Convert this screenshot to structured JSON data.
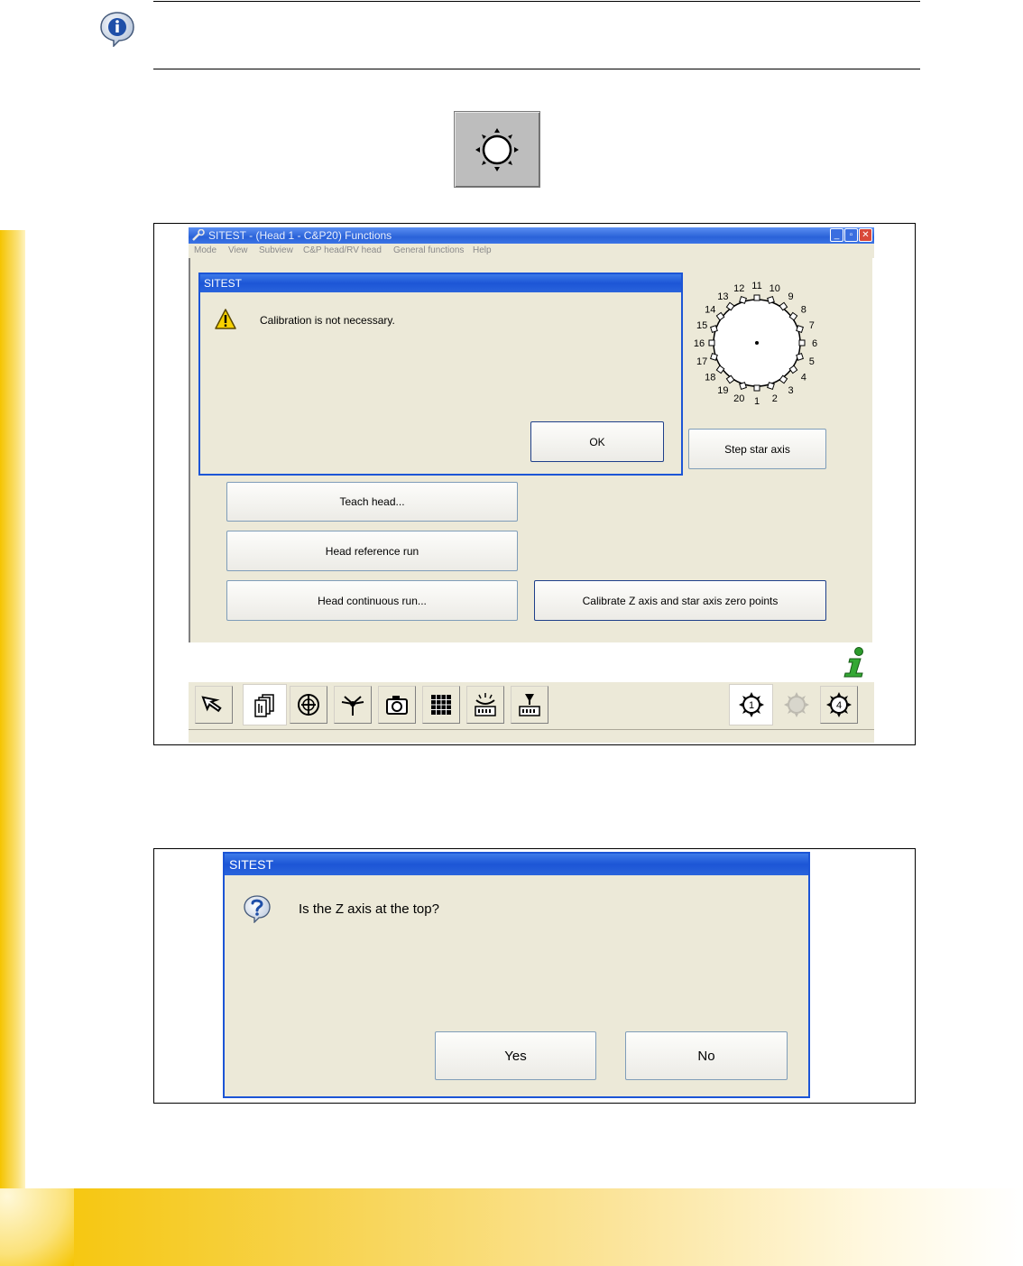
{
  "window": {
    "title": "SITEST - (Head 1 - C&P20) Functions",
    "menu": [
      "Mode",
      "View",
      "Subview",
      "C&P head/RV head",
      "General functions",
      "Help"
    ],
    "buttons": {
      "minimize": "_",
      "restore": "▫",
      "close": "✕"
    }
  },
  "calib_dialog": {
    "title": "SITEST",
    "message": "Calibration is not necessary.",
    "ok_label": "OK"
  },
  "star": {
    "labels": [
      "1",
      "2",
      "3",
      "4",
      "5",
      "6",
      "7",
      "8",
      "9",
      "10",
      "11",
      "12",
      "13",
      "14",
      "15",
      "16",
      "17",
      "18",
      "19",
      "20"
    ],
    "step_label": "Step star axis"
  },
  "functions": {
    "teach_label": "Teach head...",
    "reference_label": "Head reference run",
    "continuous_label": "Head continuous run...",
    "calibrate_label": "Calibrate Z axis and star axis zero points"
  },
  "toolbar": {
    "head_labels": [
      "1",
      "4"
    ]
  },
  "question_dialog": {
    "title": "SITEST",
    "message": "Is the Z axis at the top?",
    "yes_label": "Yes",
    "no_label": "No"
  },
  "colors": {
    "accent_yellow": "#f5c400",
    "xp_blue": "#2a62d8",
    "dialog_bg": "#ece9d8"
  }
}
